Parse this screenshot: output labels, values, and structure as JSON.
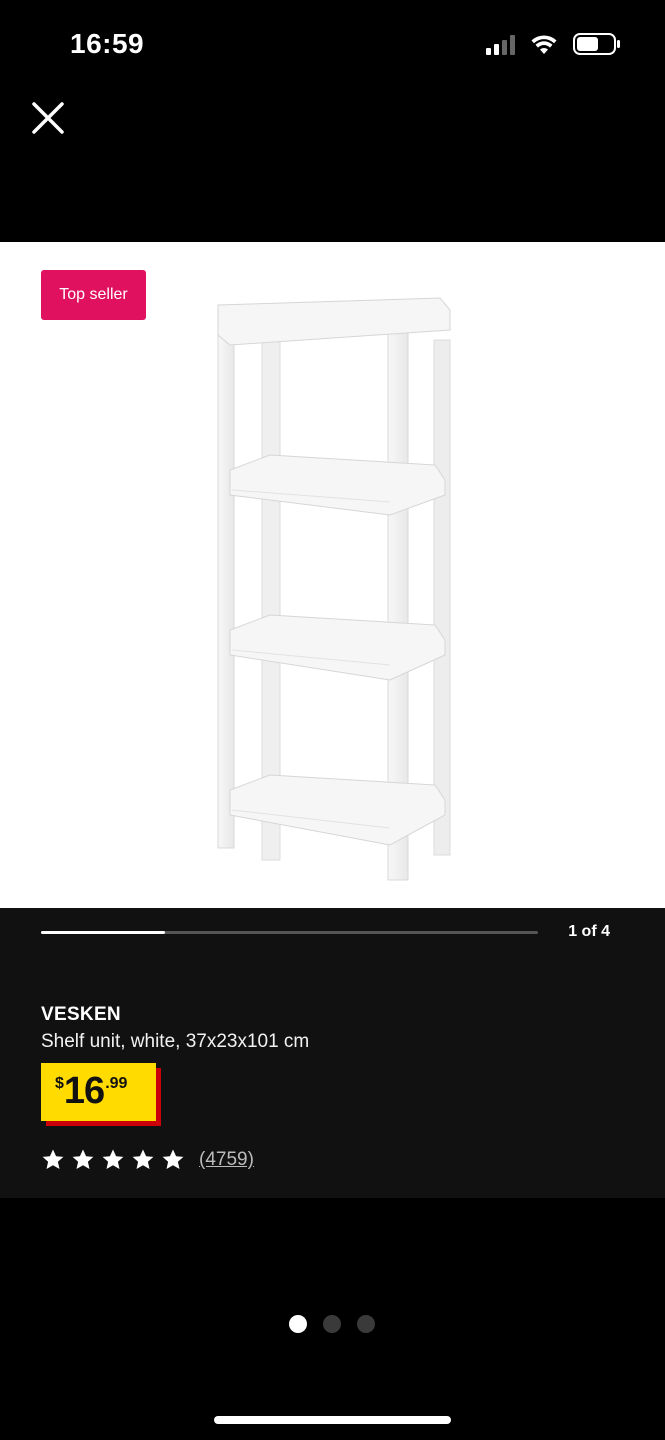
{
  "status_bar": {
    "time": "16:59",
    "icons": [
      "signal-icon",
      "wifi-icon",
      "battery-icon"
    ]
  },
  "close_icon": "close-icon",
  "image": {
    "badge": "Top seller",
    "badge_color": "#e0115f",
    "background": "#ffffff"
  },
  "gallery": {
    "counter": "1 of 4",
    "progress": 0.25
  },
  "product": {
    "name": "VESKEN",
    "description": "Shelf unit, white, 37x23x101 cm",
    "price": {
      "currency": "$",
      "integer": "16",
      "decimal": ".99",
      "box_color": "#ffdb00",
      "shadow_color": "#cc0008"
    },
    "rating": {
      "stars": 5,
      "max_stars": 5,
      "review_count": "(4759)"
    }
  },
  "pager": {
    "count": 3,
    "active_index": 0
  }
}
